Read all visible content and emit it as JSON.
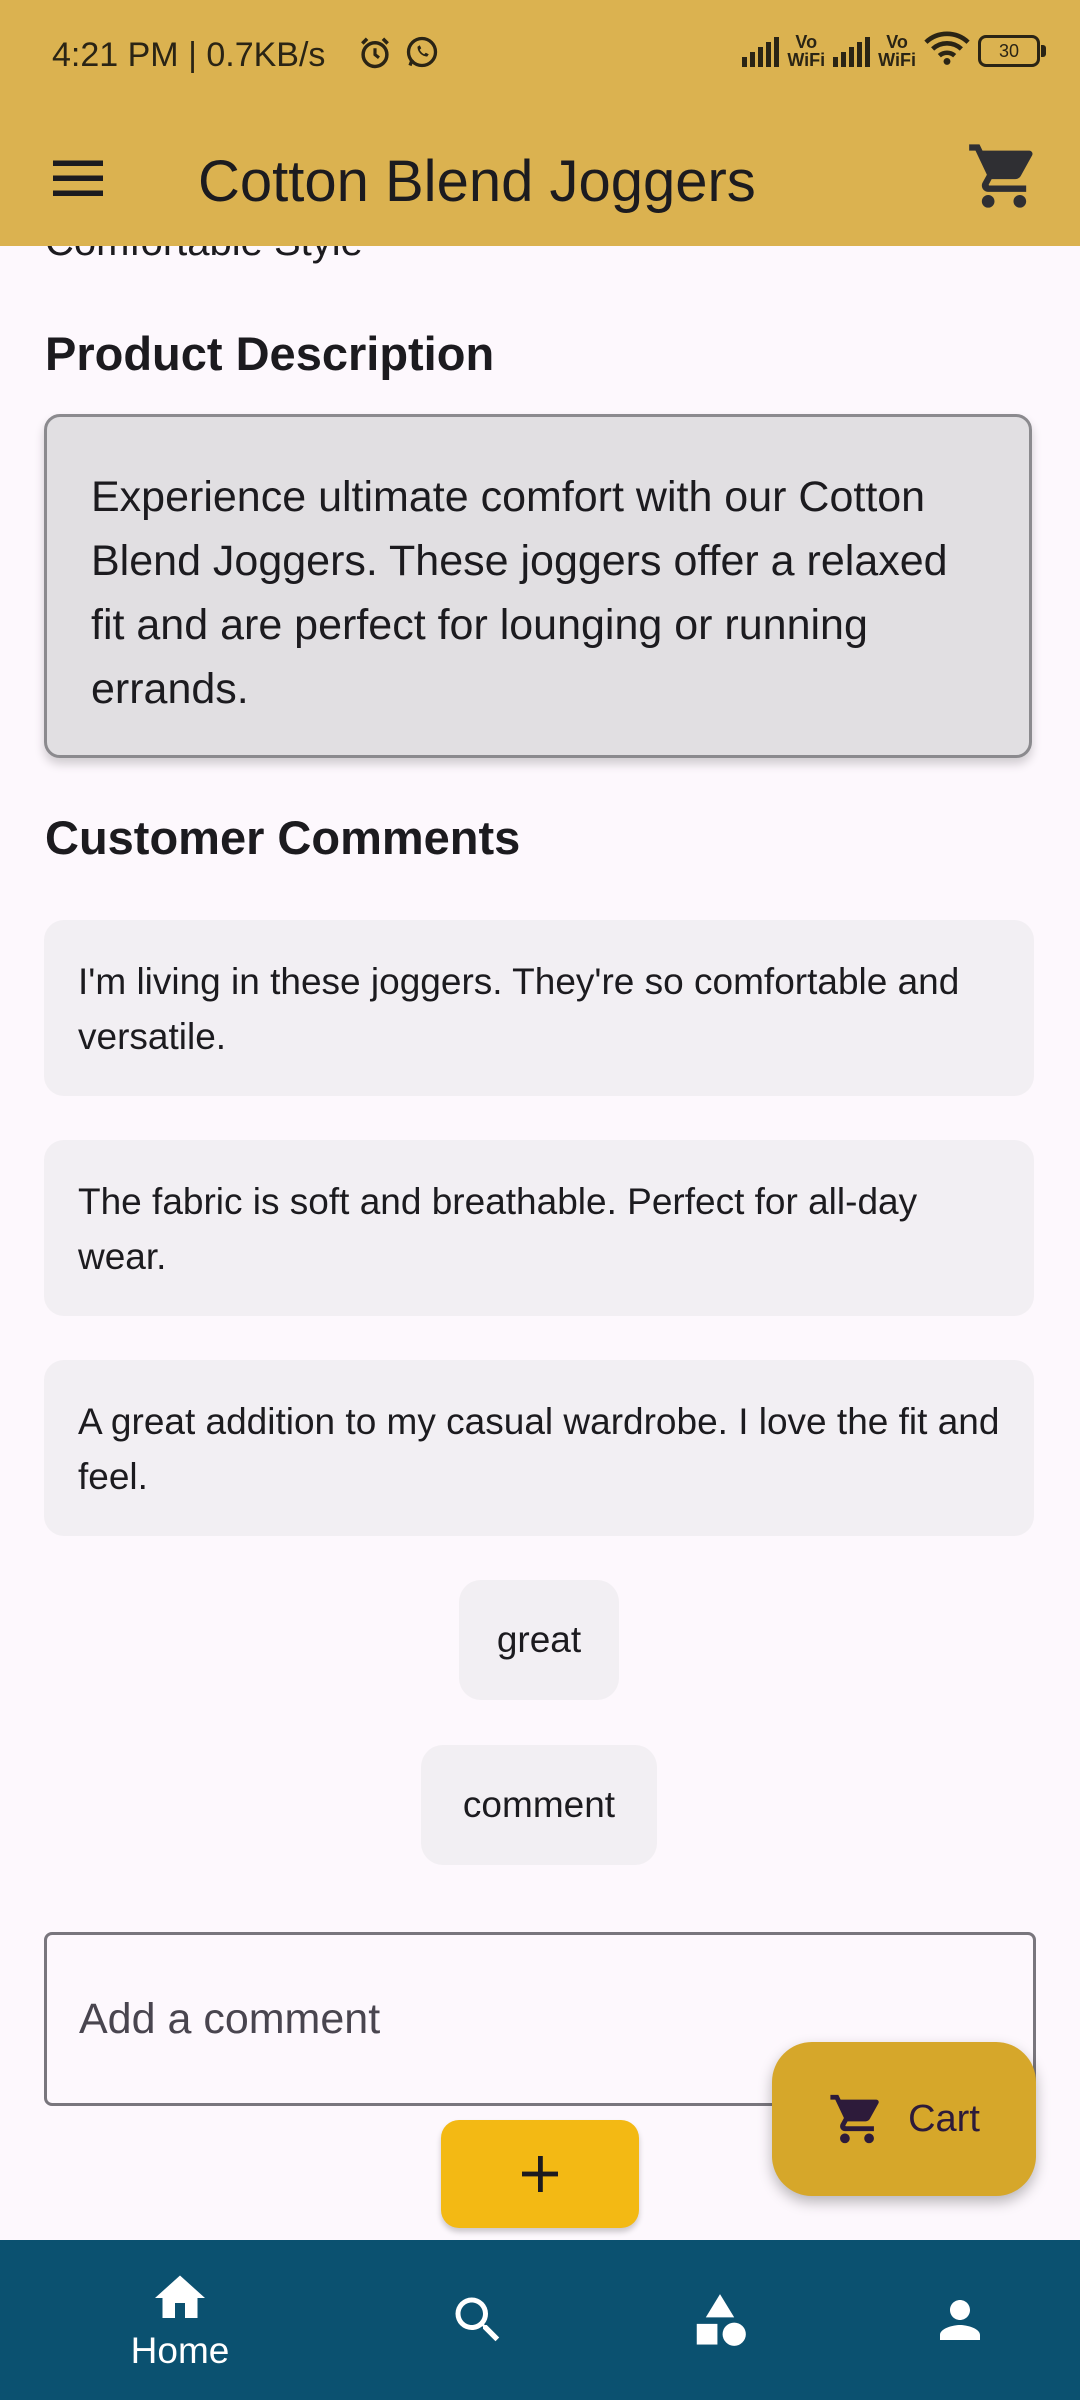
{
  "status_bar": {
    "time_speed": "4:21 PM | 0.7KB/s",
    "icons": [
      "alarm-icon",
      "whatsapp-icon",
      "signal-icon",
      "vowifi-icon",
      "signal-icon",
      "vowifi-icon",
      "wifi-icon",
      "battery-icon"
    ],
    "vowifi_label": "Vo\nWiFi",
    "battery_level": "30"
  },
  "app_bar": {
    "title": "Cotton Blend Joggers",
    "menu_icon": "menu-icon",
    "cart_icon": "cart-icon",
    "background": "#dbb250"
  },
  "main": {
    "clipped_text": "Comfortable Style",
    "description_heading": "Product Description",
    "description": "Experience ultimate comfort with our Cotton Blend Joggers. These joggers offer a relaxed fit and are perfect for lounging or running errands.",
    "comments_heading": "Customer Comments",
    "comments": [
      "I'm living in these joggers. They're so comfortable and versatile.",
      "The fabric is soft and breathable. Perfect for all-day wear.",
      "A great addition to my casual wardrobe. I love the fit and feel."
    ],
    "chips": [
      "great",
      "comment"
    ],
    "comment_input": {
      "placeholder": "Add a comment",
      "value": ""
    },
    "add_button_icon": "plus-icon",
    "add_button_color": "#f3b914"
  },
  "cart_fab": {
    "label": "Cart",
    "icon": "cart-icon",
    "color": "#d6a72a"
  },
  "bottom_nav": {
    "background": "#0b5170",
    "items": [
      {
        "icon": "home-icon",
        "label": "Home",
        "active": true
      },
      {
        "icon": "search-icon",
        "label": ""
      },
      {
        "icon": "categories-icon",
        "label": ""
      },
      {
        "icon": "profile-icon",
        "label": ""
      }
    ]
  }
}
